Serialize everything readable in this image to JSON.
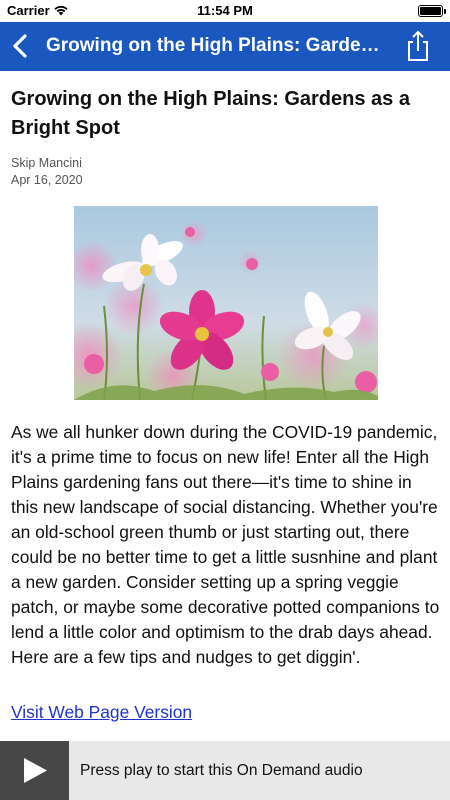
{
  "status_bar": {
    "carrier": "Carrier",
    "time": "11:54 PM"
  },
  "nav": {
    "title": "Growing on the High Plains: Gardens as a Bright Spot",
    "background_color": "#1a57be"
  },
  "article": {
    "title": "Growing on the High Plains: Gardens as a Bright Spot",
    "author": "Skip Mancini",
    "date": "Apr 16, 2020",
    "body": "As we all hunker down during the COVID-19 pandemic, it's a prime time to focus on new life! Enter all the High Plains gardening fans out there—it's time to shine in this new landscape of social distancing. Whether  you're an old-school green thumb or just starting out, there could be no better time to get a little susnhine and plant a new garden. Consider setting up a spring veggie patch, or maybe some decorative potted companions to lend a little color and optimism to the drab days ahead. Here are a few tips and nudges to get diggin'.",
    "link_label": "Visit Web Page Version",
    "link_color": "#1f36c8"
  },
  "player": {
    "prompt": "Press play to start this On Demand audio"
  },
  "icons": {
    "back": "chevron-left-icon",
    "share": "share-icon",
    "play": "play-icon",
    "wifi": "wifi-icon",
    "battery": "battery-icon"
  }
}
